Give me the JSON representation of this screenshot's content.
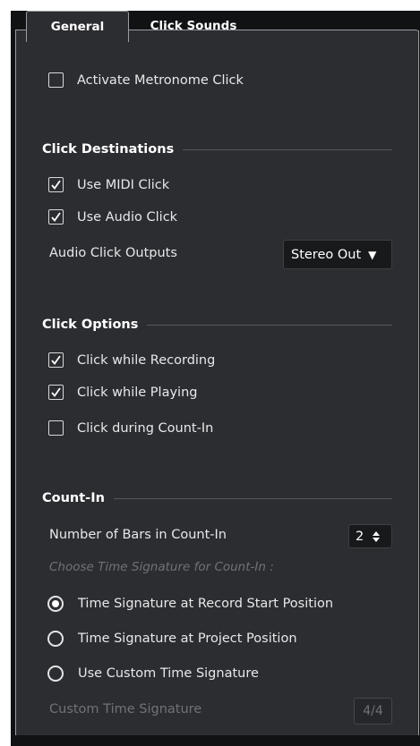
{
  "tabs": [
    {
      "label": "General",
      "active": true
    },
    {
      "label": "Click Sounds",
      "active": false
    }
  ],
  "metronome": {
    "label": "Activate Metronome Click",
    "checked": false
  },
  "click_destinations": {
    "title": "Click Destinations",
    "use_midi_click": {
      "label": "Use MIDI Click",
      "checked": true
    },
    "use_audio_click": {
      "label": "Use Audio Click",
      "checked": true
    },
    "outputs_label": "Audio Click Outputs",
    "outputs_value": "Stereo Out"
  },
  "click_options": {
    "title": "Click Options",
    "while_recording": {
      "label": "Click while Recording",
      "checked": true
    },
    "while_playing": {
      "label": "Click while Playing",
      "checked": true
    },
    "during_count_in": {
      "label": "Click during Count-In",
      "checked": false
    }
  },
  "count_in": {
    "title": "Count-In",
    "bars_label": "Number of Bars in Count-In",
    "bars_value": "2",
    "choose_label": "Choose Time Signature for Count-In :",
    "options": [
      {
        "label": "Time Signature at Record Start Position",
        "selected": true
      },
      {
        "label": "Time Signature at Project Position",
        "selected": false
      },
      {
        "label": "Use Custom Time Signature",
        "selected": false
      }
    ],
    "custom_label": "Custom Time Signature",
    "custom_value": "4/4"
  },
  "icons": {
    "check": "check-icon",
    "dropdown": "triangle-down-icon",
    "spinner": "spin-arrows-icon"
  },
  "colors": {
    "window_bg": "#111214",
    "panel_bg": "#2c2d31",
    "border": "#9a9ca2",
    "text": "#e8e8ea",
    "muted": "#707276"
  }
}
